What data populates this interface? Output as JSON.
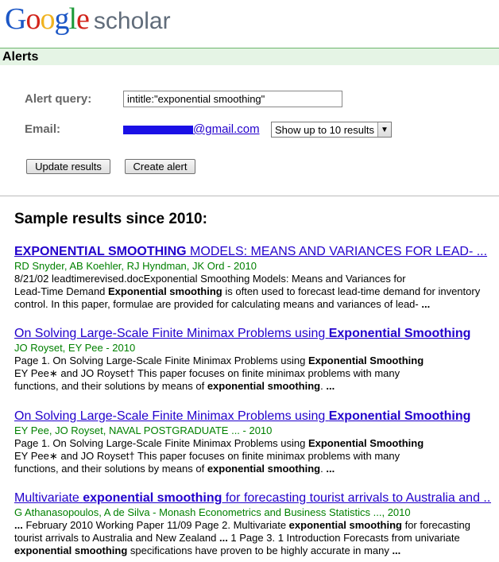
{
  "logo": {
    "letters": [
      {
        "ch": "G",
        "color": "#1c57c6"
      },
      {
        "ch": "o",
        "color": "#d2241b"
      },
      {
        "ch": "o",
        "color": "#f0b320"
      },
      {
        "ch": "g",
        "color": "#1c57c6"
      },
      {
        "ch": "l",
        "color": "#1d9a39"
      },
      {
        "ch": "e",
        "color": "#d2241b"
      }
    ],
    "suffix": "scholar"
  },
  "alerts": {
    "title": "Alerts"
  },
  "form": {
    "query_label": "Alert query:",
    "query_value": "intitle:\"exponential smoothing\"",
    "email_label": "Email:",
    "email_domain": "@gmail.com",
    "results_select": "Show up to 10 results",
    "update_button": "Update results",
    "create_button": "Create alert"
  },
  "sample": {
    "heading": "Sample results since 2010:"
  },
  "results": [
    {
      "title_parts": [
        {
          "text": "EXPONENTIAL SMOOTHING",
          "bold": true
        },
        {
          "text": " MODELS: MEANS AND VARIANCES FOR LEAD- ...",
          "bold": false
        }
      ],
      "authors": "RD Snyder, AB Koehler, RJ Hyndman, JK Ord - 2010",
      "snippet_lines": [
        [
          {
            "text": "8/21/02 leadtimerevised.docExponential Smoothing Models: Means and Variances for",
            "bold": false
          }
        ],
        [
          {
            "text": "Lead-Time Demand ",
            "bold": false
          },
          {
            "text": "Exponential smoothing",
            "bold": true
          },
          {
            "text": " is often used to forecast lead-time demand for inventory",
            "bold": false
          }
        ],
        [
          {
            "text": "control. In this paper, formulae are provided for calculating means and variances of lead- ",
            "bold": false
          },
          {
            "text": "...",
            "bold": true
          }
        ]
      ]
    },
    {
      "title_parts": [
        {
          "text": "On Solving Large-Scale Finite Minimax Problems using ",
          "bold": false
        },
        {
          "text": "Exponential Smoothing",
          "bold": true
        }
      ],
      "authors": "JO Royset, EY Pee - 2010",
      "snippet_lines": [
        [
          {
            "text": "Page 1. On Solving Large-Scale Finite Minimax Problems using ",
            "bold": false
          },
          {
            "text": "Exponential Smoothing",
            "bold": true
          }
        ],
        [
          {
            "text": "EY Pee∗ and JO Royset† This paper focuses on finite minimax problems with many",
            "bold": false
          }
        ],
        [
          {
            "text": "functions, and their solutions by means of ",
            "bold": false
          },
          {
            "text": "exponential smoothing",
            "bold": true
          },
          {
            "text": ". ",
            "bold": false
          },
          {
            "text": "...",
            "bold": true
          }
        ]
      ]
    },
    {
      "title_parts": [
        {
          "text": "On Solving Large-Scale Finite Minimax Problems using ",
          "bold": false
        },
        {
          "text": "Exponential Smoothing",
          "bold": true
        }
      ],
      "authors": "EY Pee, JO Royset, NAVAL POSTGRADUATE ... - 2010",
      "snippet_lines": [
        [
          {
            "text": "Page 1. On Solving Large-Scale Finite Minimax Problems using ",
            "bold": false
          },
          {
            "text": "Exponential Smoothing",
            "bold": true
          }
        ],
        [
          {
            "text": "EY Pee∗ and JO Royset† This paper focuses on finite minimax problems with many",
            "bold": false
          }
        ],
        [
          {
            "text": "functions, and their solutions by means of ",
            "bold": false
          },
          {
            "text": "exponential smoothing",
            "bold": true
          },
          {
            "text": ". ",
            "bold": false
          },
          {
            "text": "...",
            "bold": true
          }
        ]
      ]
    },
    {
      "title_parts": [
        {
          "text": "Multivariate ",
          "bold": false
        },
        {
          "text": "exponential smoothing",
          "bold": true
        },
        {
          "text": " for forecasting tourist arrivals to Australia and ...",
          "bold": false
        }
      ],
      "authors": "G Athanasopoulos, A de Silva - Monash Econometrics and Business Statistics ..., 2010",
      "snippet_lines": [
        [
          {
            "text": "...",
            "bold": true
          },
          {
            "text": " February 2010 Working Paper 11/09 Page 2. Multivariate ",
            "bold": false
          },
          {
            "text": "exponential smoothing",
            "bold": true
          },
          {
            "text": " for forecasting",
            "bold": false
          }
        ],
        [
          {
            "text": "tourist arrivals to Australia and New Zealand ",
            "bold": false
          },
          {
            "text": "...",
            "bold": true
          },
          {
            "text": " 1 Page 3. 1 Introduction Forecasts from univariate",
            "bold": false
          }
        ],
        [
          {
            "text": "exponential smoothing",
            "bold": true
          },
          {
            "text": " specifications have proven to be highly accurate in many ",
            "bold": false
          },
          {
            "text": "...",
            "bold": true
          }
        ]
      ]
    }
  ]
}
